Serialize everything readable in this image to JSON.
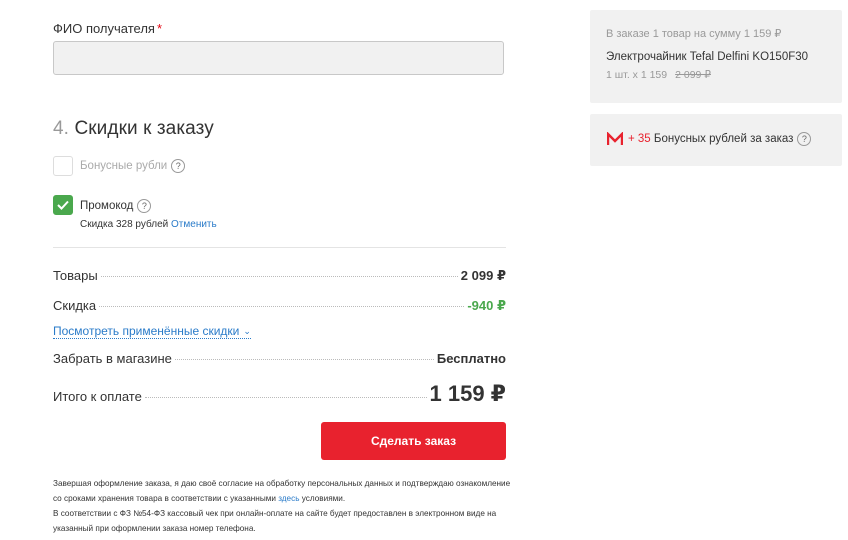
{
  "recipient": {
    "label": "ФИО получателя",
    "required_mark": "*",
    "value": ""
  },
  "discounts": {
    "number": "4.",
    "title": "Скидки к заказу",
    "bonus_checkbox": {
      "label": "Бонусные рубли",
      "help": "?",
      "checked": false
    },
    "promo_checkbox": {
      "label": "Промокод",
      "help": "?",
      "checked": true
    },
    "promo_note": "Скидка 328 рублей",
    "promo_cancel": "Отменить"
  },
  "totals": {
    "goods_label": "Товары",
    "goods_value": "2 099 ₽",
    "discount_label": "Скидка",
    "discount_value": "-940 ₽",
    "show_discounts_link": "Посмотреть применённые скидки",
    "pickup_label": "Забрать в магазине",
    "pickup_value": "Бесплатно",
    "total_label": "Итого к оплате",
    "total_value": "1 159 ₽"
  },
  "order_button": "Сделать заказ",
  "legal": {
    "part1": "Завершая оформление заказа, я даю своё согласие на обработку персональных данных и подтверждаю ознакомление со сроками хранения товара в соответствии с указанными",
    "link": "здесь",
    "part2": "условиями.",
    "part3": "В соответствии с ФЗ №54-ФЗ кассовый чек при онлайн-оплате на сайте будет предоставлен в электронном виде на указанный при оформлении заказа номер телефона."
  },
  "order_panel": {
    "summary": "В заказе 1 товар на сумму 1 159 ₽",
    "product_name": "Электрочайник Tefal Delfini KO150F30",
    "qty_price": "1 шт. x 1 159",
    "old_price": "2 099 ₽"
  },
  "bonus_panel": {
    "plus": "+ 35",
    "text": "Бонусных рублей за заказ",
    "help": "?"
  },
  "colors": {
    "accent_red": "#e8222e",
    "success_green": "#4aa84d",
    "link_blue": "#2a7bc9"
  }
}
